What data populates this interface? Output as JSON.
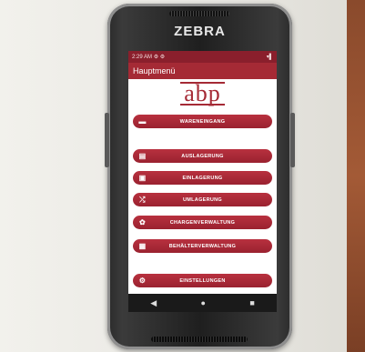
{
  "device": {
    "brand": "ZEBRA"
  },
  "status_bar": {
    "time": "2:29 AM",
    "left_icons": "⚙ ⚙",
    "right_icons": "▾▌"
  },
  "app": {
    "title": "Hauptmenü",
    "logo_text": "abp"
  },
  "menu": [
    {
      "label": "WARENEINGANG",
      "icon": "truck-icon",
      "glyph": "▬"
    },
    {
      "label": "AUSLAGERUNG",
      "icon": "clipboard-icon",
      "glyph": "▤"
    },
    {
      "label": "EINLAGERUNG",
      "icon": "box-icon",
      "glyph": "▣"
    },
    {
      "label": "UMLAGERUNG",
      "icon": "shuffle-icon",
      "glyph": "⤮"
    },
    {
      "label": "CHARGENVERWALTUNG",
      "icon": "batch-icon",
      "glyph": "✿"
    },
    {
      "label": "BEHÄLTERVERWALTUNG",
      "icon": "container-icon",
      "glyph": "▦"
    },
    {
      "label": "EINSTELLUNGEN",
      "icon": "gear-icon",
      "glyph": "⚙"
    }
  ],
  "nav": {
    "back": "◀",
    "home": "●",
    "recent": "■"
  }
}
